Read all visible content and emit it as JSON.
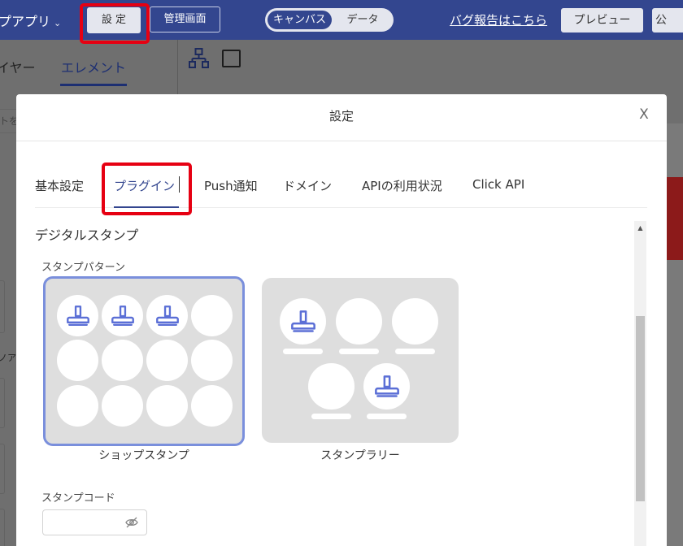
{
  "topbar": {
    "app_name": "プアプリ",
    "settings_button": "設 定",
    "admin_button": "管理画面",
    "view_toggle": {
      "canvas": "キャンバス",
      "data": "データ"
    },
    "bug_report_link": "バグ報告はこちら",
    "preview_button": "プレビュー",
    "publish_button": "公",
    "bar_color": "#33468f"
  },
  "left_panel": {
    "tab_layer": "イヤー",
    "tab_element": "エレメント",
    "search_placeholder": "トを",
    "section_label": "ノア"
  },
  "toolbar_icons": [
    "hierarchy-icon",
    "square-icon"
  ],
  "modal": {
    "title": "設定",
    "close": "X",
    "tabs": [
      {
        "label": "基本設定",
        "active": false
      },
      {
        "label": "プラグイン",
        "active": true
      },
      {
        "label": "Push通知",
        "active": false
      },
      {
        "label": "ドメイン",
        "active": false
      },
      {
        "label": "APIの利用状況",
        "active": false
      },
      {
        "label": "Click API",
        "active": false
      }
    ],
    "section_title": "デジタルスタンプ",
    "pattern_label": "スタンプパターン",
    "patterns": [
      {
        "caption": "ショップスタンプ",
        "selected": true
      },
      {
        "caption": "スタンプラリー",
        "selected": false
      }
    ],
    "code_label": "スタンプコード",
    "code_value": "",
    "accent_color": "#33468f",
    "selected_border_color": "#7a8fdc",
    "stamp_icon": "stamp-icon",
    "highlight_color": "#e60012"
  }
}
